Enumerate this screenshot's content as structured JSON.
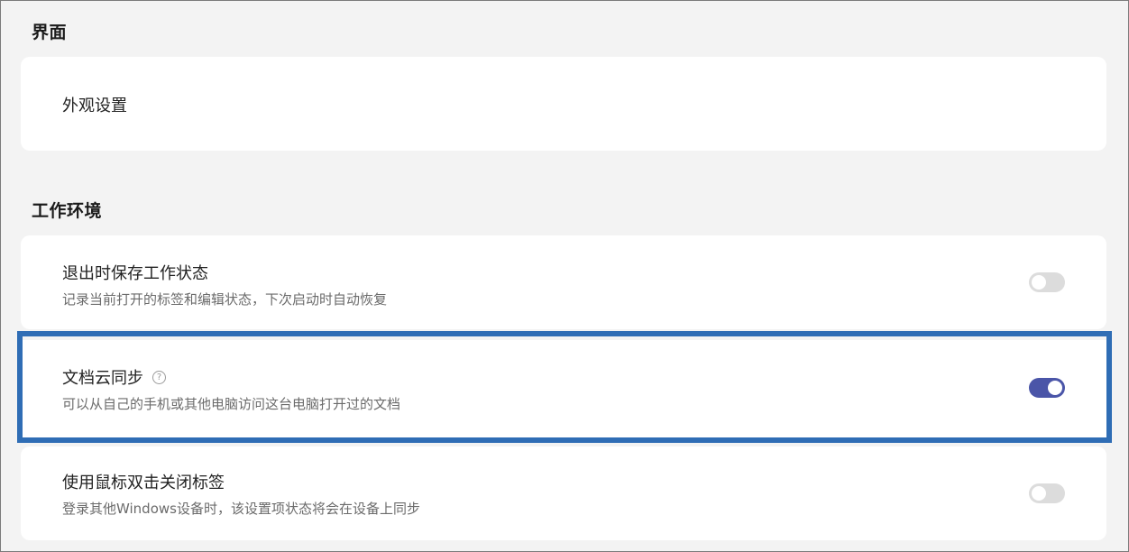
{
  "sections": {
    "interface": {
      "title": "界面",
      "items": [
        {
          "label": "外观设置"
        }
      ]
    },
    "workspace": {
      "title": "工作环境",
      "items": [
        {
          "title": "退出时保存工作状态",
          "description": "记录当前打开的标签和编辑状态，下次启动时自动恢复",
          "toggle": "off"
        },
        {
          "title": "文档云同步",
          "description": "可以从自己的手机或其他电脑访问这台电脑打开过的文档",
          "toggle": "on",
          "help_icon": "question-circle-icon",
          "help_glyph": "?"
        },
        {
          "title": "使用鼠标双击关闭标签",
          "description": "登录其他Windows设备时，该设置项状态将会在设备上同步",
          "toggle": "off"
        }
      ]
    }
  },
  "colors": {
    "toggle_on": "#4a55a8",
    "toggle_off": "#dcdcdc",
    "highlight_border": "#2f6db5",
    "background": "#f3f3f3"
  }
}
